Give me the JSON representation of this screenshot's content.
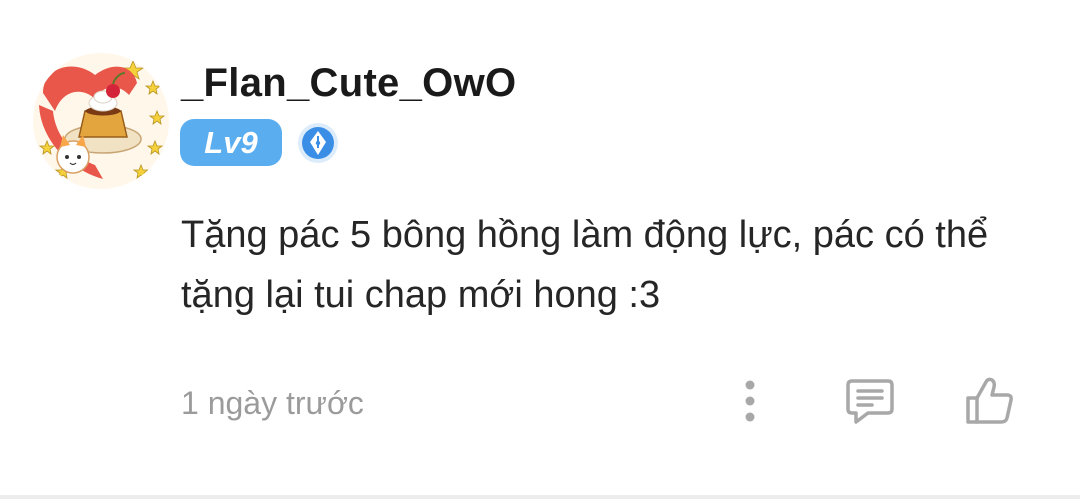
{
  "comment": {
    "username": "_Flan_Cute_OwO",
    "level": "Lv9",
    "role_badge_icon": "pen-nib-icon",
    "text": "Tặng pác 5 bông hồng làm động lực, pác có thể tặng lại tui chap mới hong :3",
    "timestamp": "1 ngày trước"
  },
  "actions": {
    "more_icon": "more-vertical-icon",
    "reply_icon": "message-icon",
    "like_icon": "thumbs-up-icon"
  },
  "colors": {
    "level_badge": "#5aaef0",
    "role_badge": "#3a8ee6",
    "text": "#262626",
    "muted": "#9b9b9b",
    "icon": "#a8a8a8"
  }
}
